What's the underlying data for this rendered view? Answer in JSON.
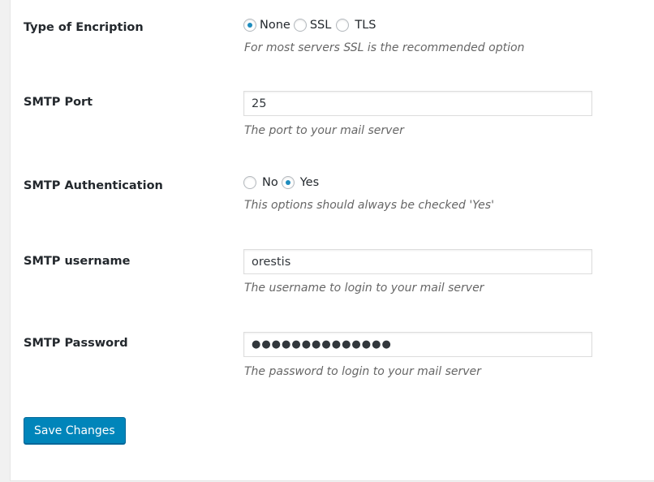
{
  "encryption": {
    "label": "Type of Encription",
    "options": [
      {
        "label": "None",
        "checked": true
      },
      {
        "label": "SSL",
        "checked": false
      },
      {
        "label": "TLS",
        "checked": false
      }
    ],
    "description": "For most servers SSL is the recommended option"
  },
  "port": {
    "label": "SMTP Port",
    "value": "25",
    "description": "The port to your mail server"
  },
  "authentication": {
    "label": "SMTP Authentication",
    "options": [
      {
        "label": "No",
        "checked": false
      },
      {
        "label": "Yes",
        "checked": true
      }
    ],
    "description": "This options should always be checked 'Yes'"
  },
  "username": {
    "label": "SMTP username",
    "value": "orestis",
    "description": "The username to login to your mail server"
  },
  "password": {
    "label": "SMTP Password",
    "value": "●●●●●●●●●●●●●●",
    "description": "The password to login to your mail server"
  },
  "save_button": {
    "label": "Save Changes"
  },
  "colors": {
    "primary": "#0085ba",
    "radio_dot": "#1e8cbe"
  }
}
